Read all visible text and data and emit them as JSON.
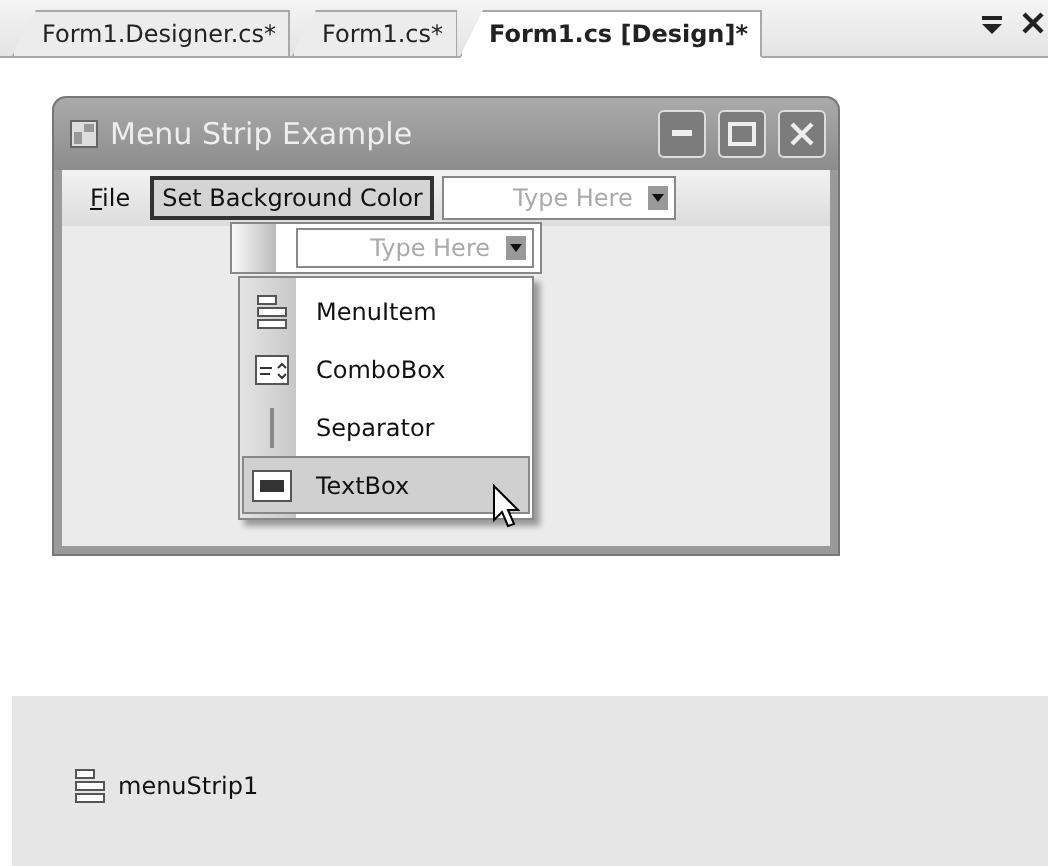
{
  "tabs": [
    {
      "label": "Form1.Designer.cs*",
      "selected": false
    },
    {
      "label": "Form1.cs*",
      "selected": false
    },
    {
      "label": "Form1.cs [Design]*",
      "selected": true
    }
  ],
  "form": {
    "title": "Menu Strip Example",
    "menu_items": [
      {
        "label": "File",
        "selected": false,
        "kind": "item"
      },
      {
        "label": "Set Background Color",
        "selected": true,
        "kind": "item"
      },
      {
        "label": "Type Here",
        "kind": "placeholder"
      }
    ],
    "submenu": {
      "placeholder": "Type Here"
    },
    "add_menu": [
      {
        "label": "MenuItem",
        "kind": "menuitem",
        "selected": false
      },
      {
        "label": "ComboBox",
        "kind": "combobox",
        "selected": false
      },
      {
        "label": "Separator",
        "kind": "separator",
        "selected": false
      },
      {
        "label": "TextBox",
        "kind": "textbox",
        "selected": true
      }
    ]
  },
  "tray": {
    "components": [
      {
        "label": "menuStrip1"
      }
    ]
  }
}
